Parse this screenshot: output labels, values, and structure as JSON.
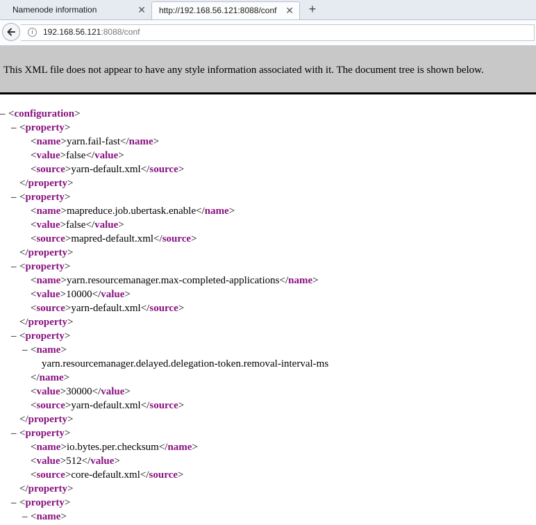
{
  "browser": {
    "tabs": [
      {
        "label": "Namenode information",
        "close": "✕",
        "active": false
      },
      {
        "label": "http://192.168.56.121:8088/conf",
        "close": "✕",
        "active": true
      }
    ],
    "new_tab": "+",
    "url_host": "192.168.56.121",
    "url_rest": ":8088/conf"
  },
  "banner": "This XML file does not appear to have any style information associated with it. The document tree is shown below.",
  "xml": {
    "toggle": "–",
    "root_tag": "configuration",
    "property_tag": "property",
    "fields": {
      "name": "name",
      "value": "value",
      "source": "source"
    },
    "properties": [
      {
        "name": "yarn.fail-fast",
        "value": "false",
        "source": "yarn-default.xml"
      },
      {
        "name": "mapreduce.job.ubertask.enable",
        "value": "false",
        "source": "mapred-default.xml"
      },
      {
        "name": "yarn.resourcemanager.max-completed-applications",
        "value": "10000",
        "source": "yarn-default.xml"
      },
      {
        "name": "yarn.resourcemanager.delayed.delegation-token.removal-interval-ms",
        "value": "30000",
        "source": "yarn-default.xml"
      },
      {
        "name": "io.bytes.per.checksum",
        "value": "512",
        "source": "core-default.xml"
      }
    ]
  }
}
